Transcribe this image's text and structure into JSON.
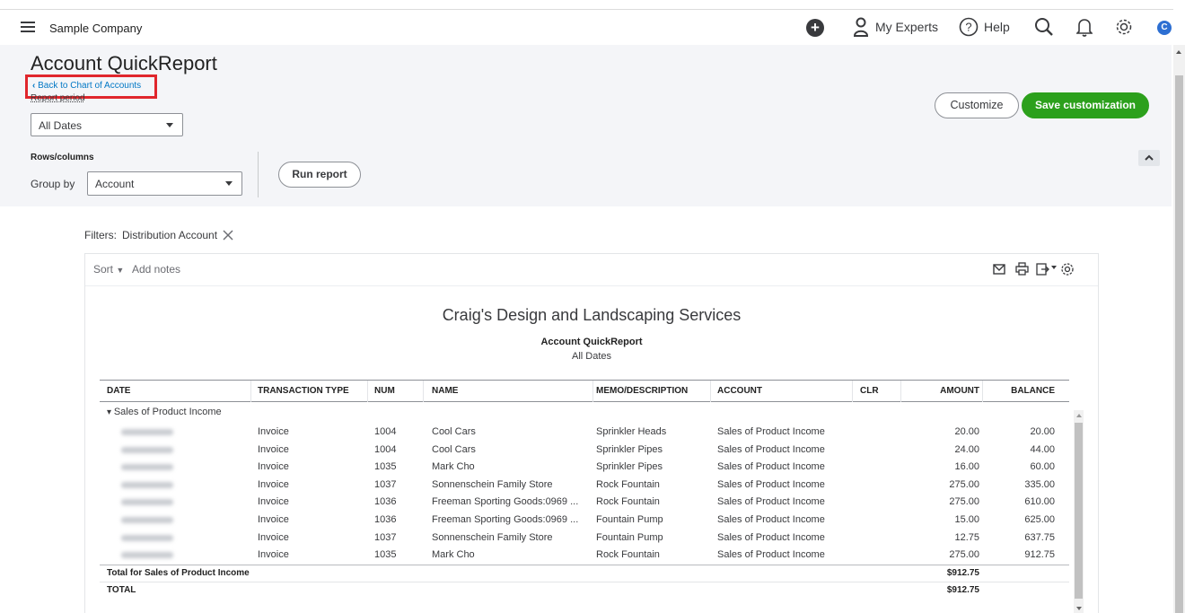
{
  "topbar": {
    "company": "Sample Company",
    "experts_label": "My Experts",
    "help_label": "Help",
    "avatar_letter": "C"
  },
  "header": {
    "title": "Account QuickReport",
    "back_link": "Back to Chart of Accounts",
    "report_period_label": "Report period",
    "report_period_value": "All Dates",
    "rows_columns_label": "Rows/columns",
    "group_by_label": "Group by",
    "group_by_value": "Account",
    "run_report": "Run report",
    "customize": "Customize",
    "save_customization": "Save customization"
  },
  "filters": {
    "label": "Filters:",
    "chip": "Distribution Account"
  },
  "report": {
    "sort_label": "Sort",
    "add_notes": "Add notes",
    "company_title": "Craig's Design and Landscaping Services",
    "name": "Account QuickReport",
    "dates": "All Dates",
    "columns": [
      "DATE",
      "TRANSACTION TYPE",
      "NUM",
      "NAME",
      "MEMO/DESCRIPTION",
      "ACCOUNT",
      "CLR",
      "AMOUNT",
      "BALANCE"
    ],
    "group_label": "Sales of Product Income",
    "rows": [
      {
        "type": "Invoice",
        "num": "1004",
        "name": "Cool Cars",
        "memo": "Sprinkler Heads",
        "account": "Sales of Product Income",
        "clr": "",
        "amount": "20.00",
        "balance": "20.00"
      },
      {
        "type": "Invoice",
        "num": "1004",
        "name": "Cool Cars",
        "memo": "Sprinkler Pipes",
        "account": "Sales of Product Income",
        "clr": "",
        "amount": "24.00",
        "balance": "44.00"
      },
      {
        "type": "Invoice",
        "num": "1035",
        "name": "Mark Cho",
        "memo": "Sprinkler Pipes",
        "account": "Sales of Product Income",
        "clr": "",
        "amount": "16.00",
        "balance": "60.00"
      },
      {
        "type": "Invoice",
        "num": "1037",
        "name": "Sonnenschein Family Store",
        "memo": "Rock Fountain",
        "account": "Sales of Product Income",
        "clr": "",
        "amount": "275.00",
        "balance": "335.00"
      },
      {
        "type": "Invoice",
        "num": "1036",
        "name": "Freeman Sporting Goods:0969 ...",
        "memo": "Rock Fountain",
        "account": "Sales of Product Income",
        "clr": "",
        "amount": "275.00",
        "balance": "610.00"
      },
      {
        "type": "Invoice",
        "num": "1036",
        "name": "Freeman Sporting Goods:0969 ...",
        "memo": "Fountain Pump",
        "account": "Sales of Product Income",
        "clr": "",
        "amount": "15.00",
        "balance": "625.00"
      },
      {
        "type": "Invoice",
        "num": "1037",
        "name": "Sonnenschein Family Store",
        "memo": "Fountain Pump",
        "account": "Sales of Product Income",
        "clr": "",
        "amount": "12.75",
        "balance": "637.75"
      },
      {
        "type": "Invoice",
        "num": "1035",
        "name": "Mark Cho",
        "memo": "Rock Fountain",
        "account": "Sales of Product Income",
        "clr": "",
        "amount": "275.00",
        "balance": "912.75"
      }
    ],
    "total_label": "Total for Sales of Product Income",
    "total_amount": "$912.75",
    "grand_label": "TOTAL",
    "grand_amount": "$912.75"
  },
  "colors": {
    "accent_green": "#2ca01c",
    "link_blue": "#0077c5",
    "highlight_red": "#e0262c"
  },
  "icons": [
    "menu-icon",
    "plus-icon",
    "experts-icon",
    "help-icon",
    "search-icon",
    "bell-icon",
    "gear-icon",
    "mail-icon",
    "print-icon",
    "export-icon",
    "settings-icon",
    "close-icon",
    "chevron-up-icon"
  ]
}
